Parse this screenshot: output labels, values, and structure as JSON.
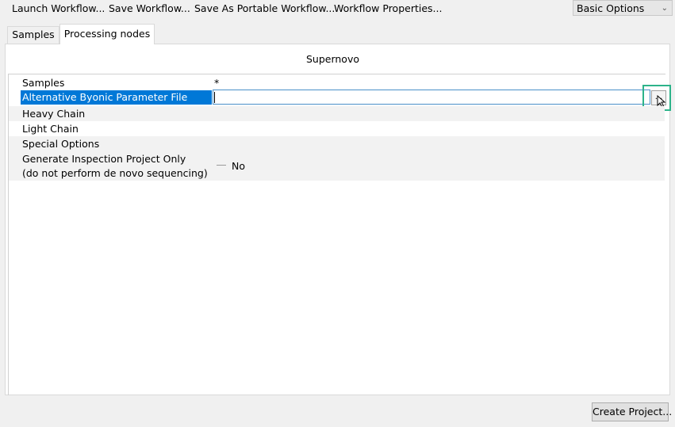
{
  "toolbar": {
    "launch": "Launch Workflow...",
    "save": "Save Workflow...",
    "save_portable": "Save As Portable Workflow...",
    "properties": "Workflow Properties...",
    "options_selected": "Basic Options"
  },
  "tabs": [
    {
      "label": "Samples"
    },
    {
      "label": "Processing nodes"
    }
  ],
  "panel": {
    "title": "Supernovo",
    "rows": [
      {
        "label": "Samples",
        "value": "*"
      },
      {
        "label": "Alternative Byonic Parameter File",
        "value": ""
      },
      {
        "label": "Heavy Chain"
      },
      {
        "label": "Light Chain"
      },
      {
        "label": "Special Options"
      },
      {
        "label_line1": "Generate Inspection Project Only",
        "label_line2": "(do not perform de novo sequencing)",
        "value": "No"
      }
    ],
    "browse_label": "..."
  },
  "footer": {
    "create_project": "Create Project..."
  },
  "colors": {
    "selection": "#0078d7",
    "highlight_border": "#2db38a"
  }
}
